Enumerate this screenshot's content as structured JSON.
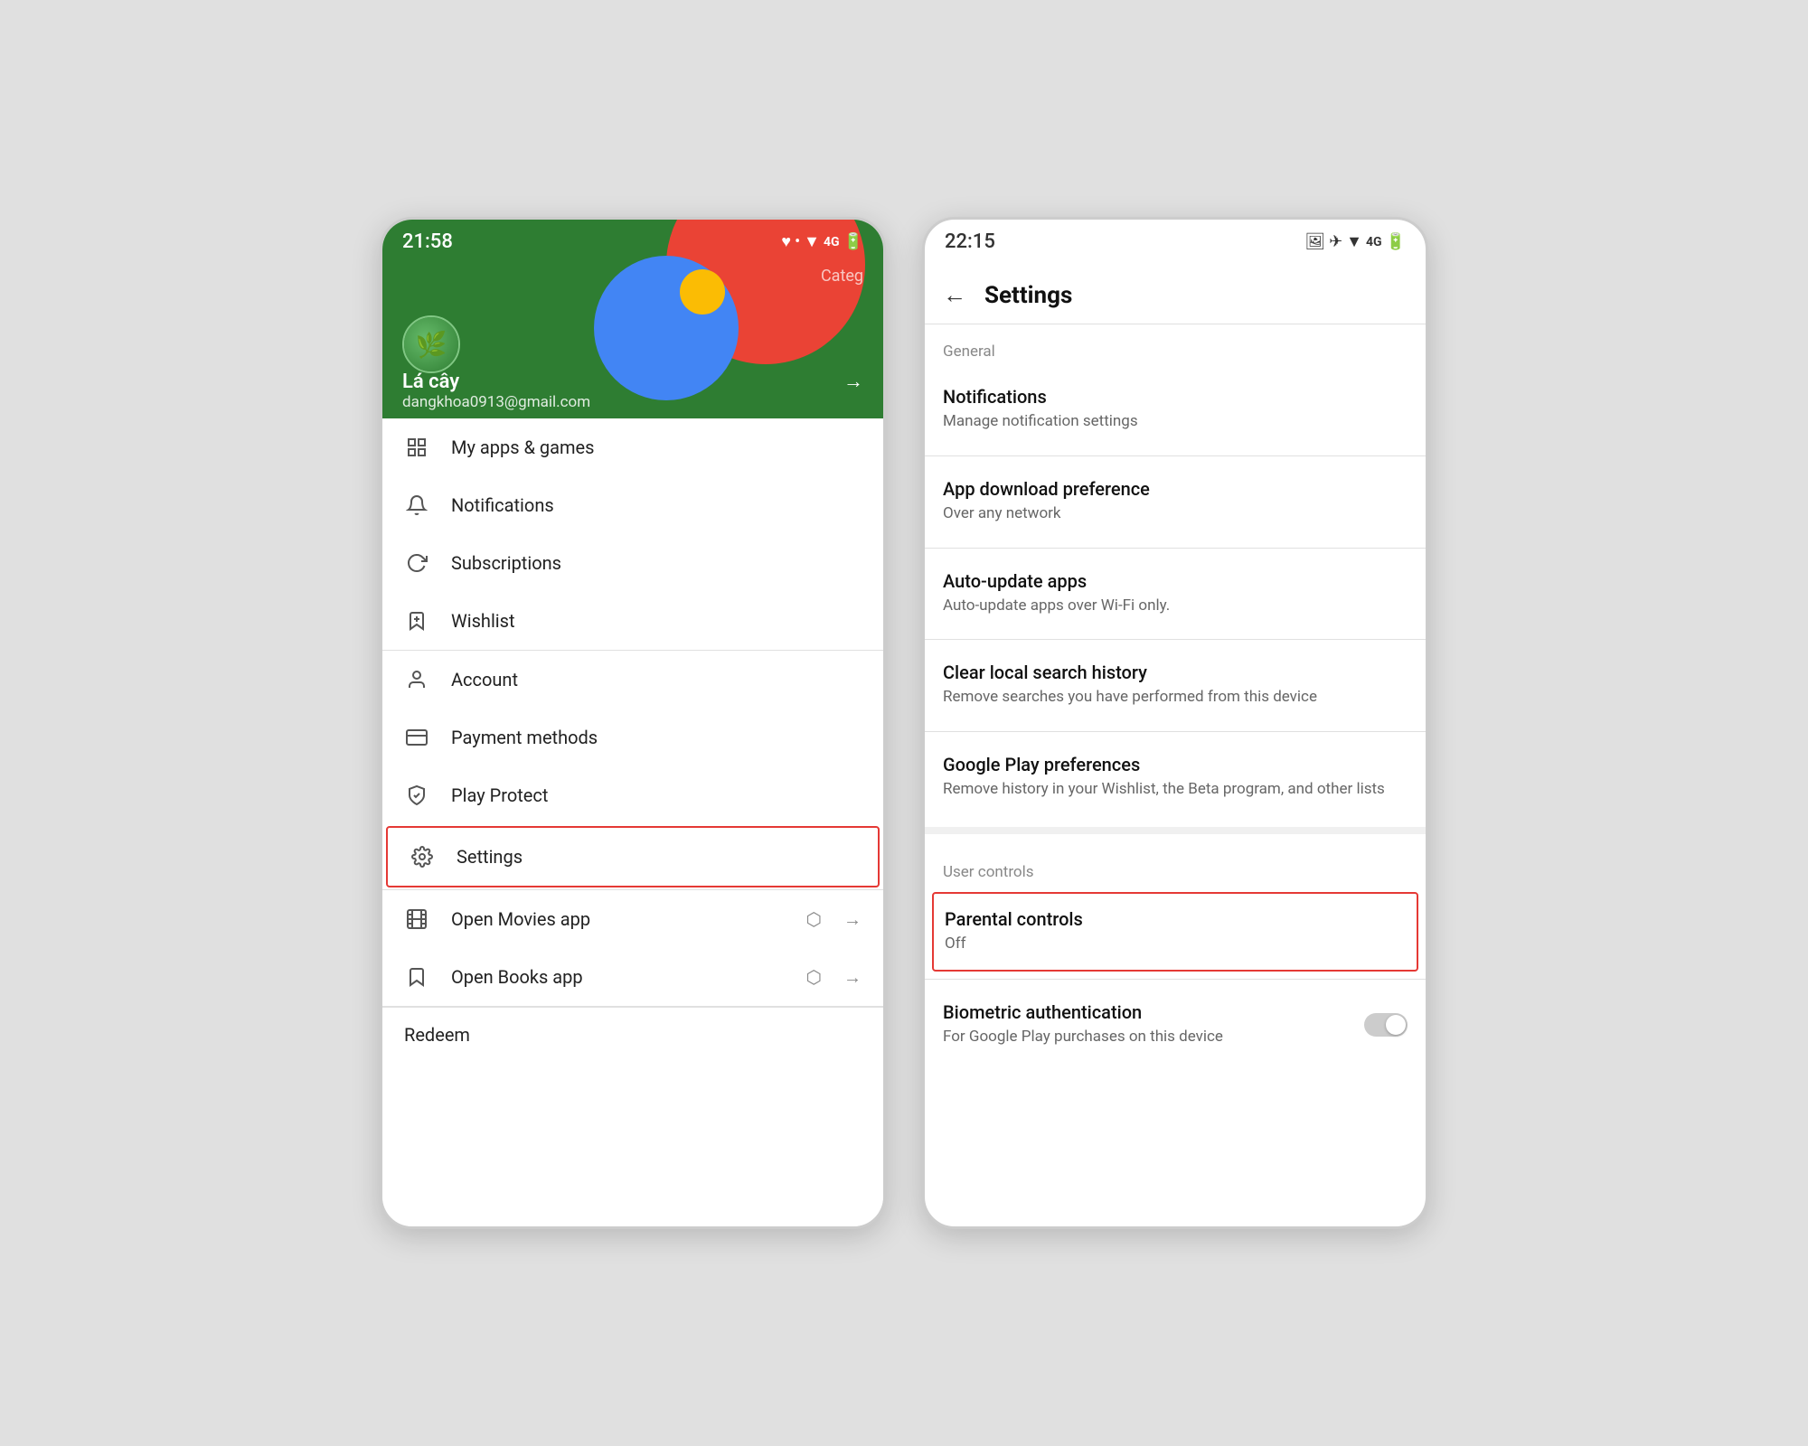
{
  "left_phone": {
    "status_bar": {
      "time": "21:58",
      "icons": "♥ • ▼ 4G 🔋"
    },
    "header": {
      "user_name": "Lá cây",
      "user_email": "dangkhoa0913@gmail.com"
    },
    "menu_sections": {
      "section1": [
        {
          "icon": "grid",
          "label": "My apps & games",
          "ext": ""
        },
        {
          "icon": "bell",
          "label": "Notifications",
          "ext": ""
        },
        {
          "icon": "refresh",
          "label": "Subscriptions",
          "ext": ""
        },
        {
          "icon": "bookmark",
          "label": "Wishlist",
          "ext": ""
        }
      ],
      "section2": [
        {
          "icon": "person",
          "label": "Account",
          "ext": ""
        },
        {
          "icon": "card",
          "label": "Payment methods",
          "ext": ""
        },
        {
          "icon": "shield",
          "label": "Play Protect",
          "ext": ""
        },
        {
          "icon": "gear",
          "label": "Settings",
          "ext": "",
          "highlighted": true
        }
      ],
      "section3": [
        {
          "icon": "film",
          "label": "Open Movies app",
          "ext": "→"
        },
        {
          "icon": "book",
          "label": "Open Books app",
          "ext": "→"
        }
      ]
    },
    "redeem": "Redeem"
  },
  "right_phone": {
    "status_bar": {
      "time": "22:15",
      "icons": "🖼 ✈ ▼ 4G 🔋"
    },
    "header": {
      "title": "Settings",
      "back_label": "←"
    },
    "general_label": "General",
    "items": [
      {
        "title": "Notifications",
        "subtitle": "Manage notification settings"
      },
      {
        "title": "App download preference",
        "subtitle": "Over any network"
      },
      {
        "title": "Auto-update apps",
        "subtitle": "Auto-update apps over Wi-Fi only."
      },
      {
        "title": "Clear local search history",
        "subtitle": "Remove searches you have performed from this device"
      },
      {
        "title": "Google Play preferences",
        "subtitle": "Remove history in your Wishlist, the Beta program, and other lists"
      }
    ],
    "user_controls_label": "User controls",
    "parental_controls": {
      "title": "Parental controls",
      "subtitle": "Off"
    },
    "biometric": {
      "title": "Biometric authentication",
      "subtitle": "For Google Play purchases on this device",
      "toggle_on": false
    }
  }
}
